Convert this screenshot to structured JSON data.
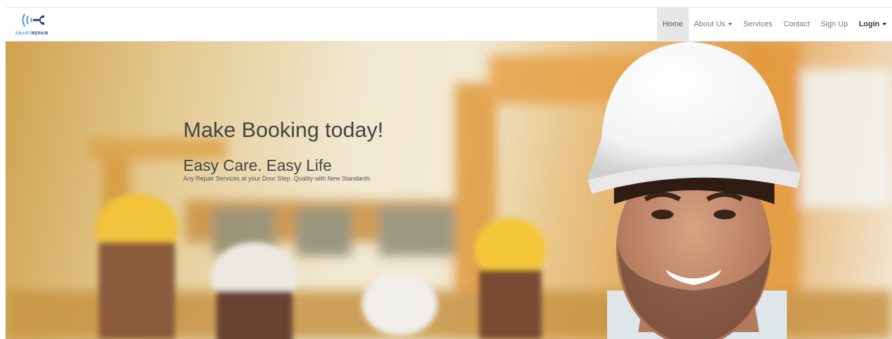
{
  "brand": {
    "logo_icon": "signal-wrench-logo",
    "name_part1": "SMART",
    "name_part2": "REPAIR",
    "colors": {
      "light_blue": "#5aa0d8",
      "dark_blue": "#1a3f7a"
    }
  },
  "nav": {
    "items": [
      {
        "label": "Home",
        "active": true,
        "dropdown": false
      },
      {
        "label": "About Us",
        "active": false,
        "dropdown": true
      },
      {
        "label": "Services",
        "active": false,
        "dropdown": false
      },
      {
        "label": "Contact",
        "active": false,
        "dropdown": false
      },
      {
        "label": "Sign Up",
        "active": false,
        "dropdown": false
      },
      {
        "label": "Login",
        "active": false,
        "dropdown": true
      }
    ]
  },
  "hero": {
    "title": "Make Booking today!",
    "subtitle": "Easy Care. Easy Life",
    "description": "Any Repair Services at your Door Step. Quality with New Standards",
    "image": "smiling-construction-worker-in-white-hard-hat"
  }
}
